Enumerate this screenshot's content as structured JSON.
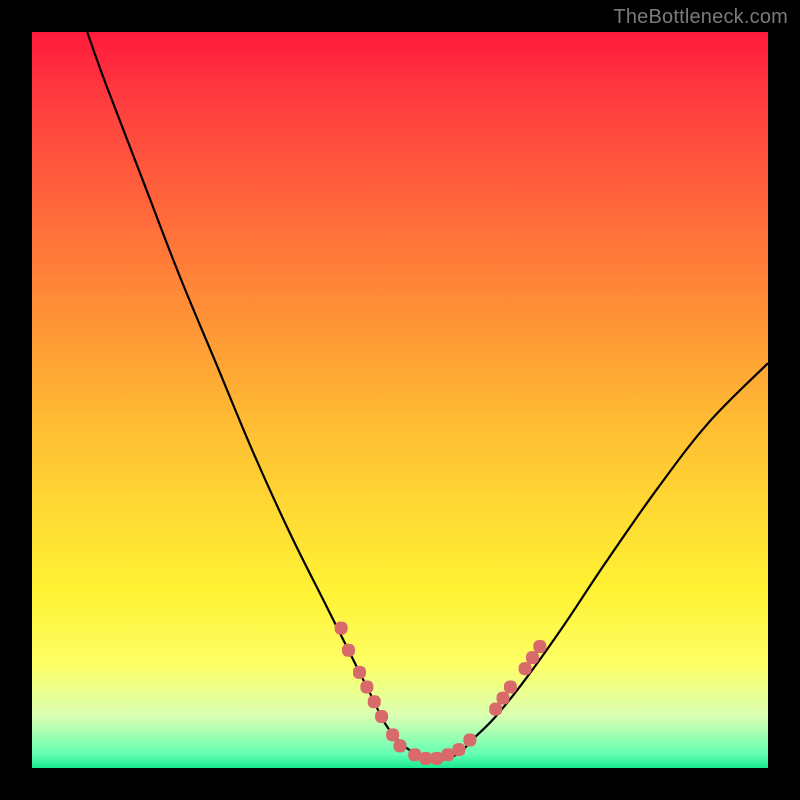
{
  "watermark": "TheBottleneck.com",
  "colors": {
    "frame": "#000000",
    "curve": "#000000",
    "marker": "#d86a6a",
    "gradient_top": "#ff1a3c",
    "gradient_bottom": "#18e890"
  },
  "chart_data": {
    "type": "line",
    "title": "",
    "xlabel": "",
    "ylabel": "",
    "xlim": [
      0,
      100
    ],
    "ylim": [
      0,
      100
    ],
    "series": [
      {
        "name": "curve",
        "x": [
          7.5,
          10,
          15,
          20,
          25,
          30,
          35,
          40,
          43,
          46,
          48,
          50,
          52,
          54,
          56,
          58,
          60,
          63,
          67,
          72,
          78,
          85,
          92,
          100
        ],
        "y": [
          100,
          93,
          80,
          67,
          55,
          43,
          32,
          22,
          16,
          10,
          6,
          3.5,
          2,
          1.2,
          1.2,
          2,
          4,
          7,
          12,
          19,
          28,
          38,
          47,
          55
        ]
      }
    ],
    "markers": [
      {
        "x": 42,
        "y": 19
      },
      {
        "x": 43,
        "y": 16
      },
      {
        "x": 44.5,
        "y": 13
      },
      {
        "x": 45.5,
        "y": 11
      },
      {
        "x": 46.5,
        "y": 9
      },
      {
        "x": 47.5,
        "y": 7
      },
      {
        "x": 49,
        "y": 4.5
      },
      {
        "x": 50,
        "y": 3
      },
      {
        "x": 52,
        "y": 1.8
      },
      {
        "x": 53.5,
        "y": 1.3
      },
      {
        "x": 55,
        "y": 1.3
      },
      {
        "x": 56.5,
        "y": 1.8
      },
      {
        "x": 58,
        "y": 2.5
      },
      {
        "x": 59.5,
        "y": 3.8
      },
      {
        "x": 63,
        "y": 8
      },
      {
        "x": 64,
        "y": 9.5
      },
      {
        "x": 65,
        "y": 11
      },
      {
        "x": 67,
        "y": 13.5
      },
      {
        "x": 68,
        "y": 15
      },
      {
        "x": 69,
        "y": 16.5
      }
    ]
  }
}
